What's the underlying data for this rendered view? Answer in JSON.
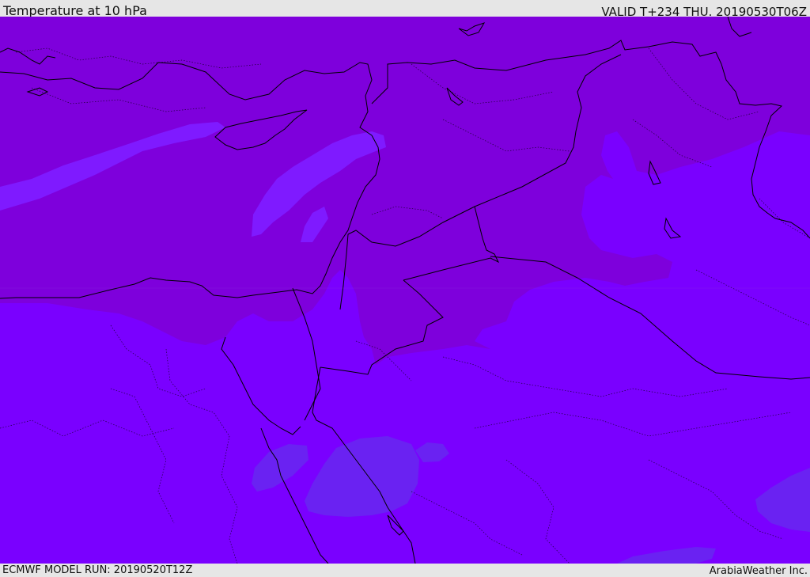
{
  "header": {
    "title": "Temperature at 10 hPa",
    "valid": "VALID T+234 THU. 20190530T06Z"
  },
  "footer": {
    "model_run": "ECMWF MODEL RUN: 20190520T12Z",
    "credit": "ArabiaWeather Inc."
  },
  "colors": {
    "frame": "#e6e6e6",
    "warm_band": "#7e00dc",
    "cool_band": "#7a00ff",
    "lighter_patch": "#7f1aff",
    "bluish_patch": "#6a22f2",
    "border_line": "#000000"
  }
}
